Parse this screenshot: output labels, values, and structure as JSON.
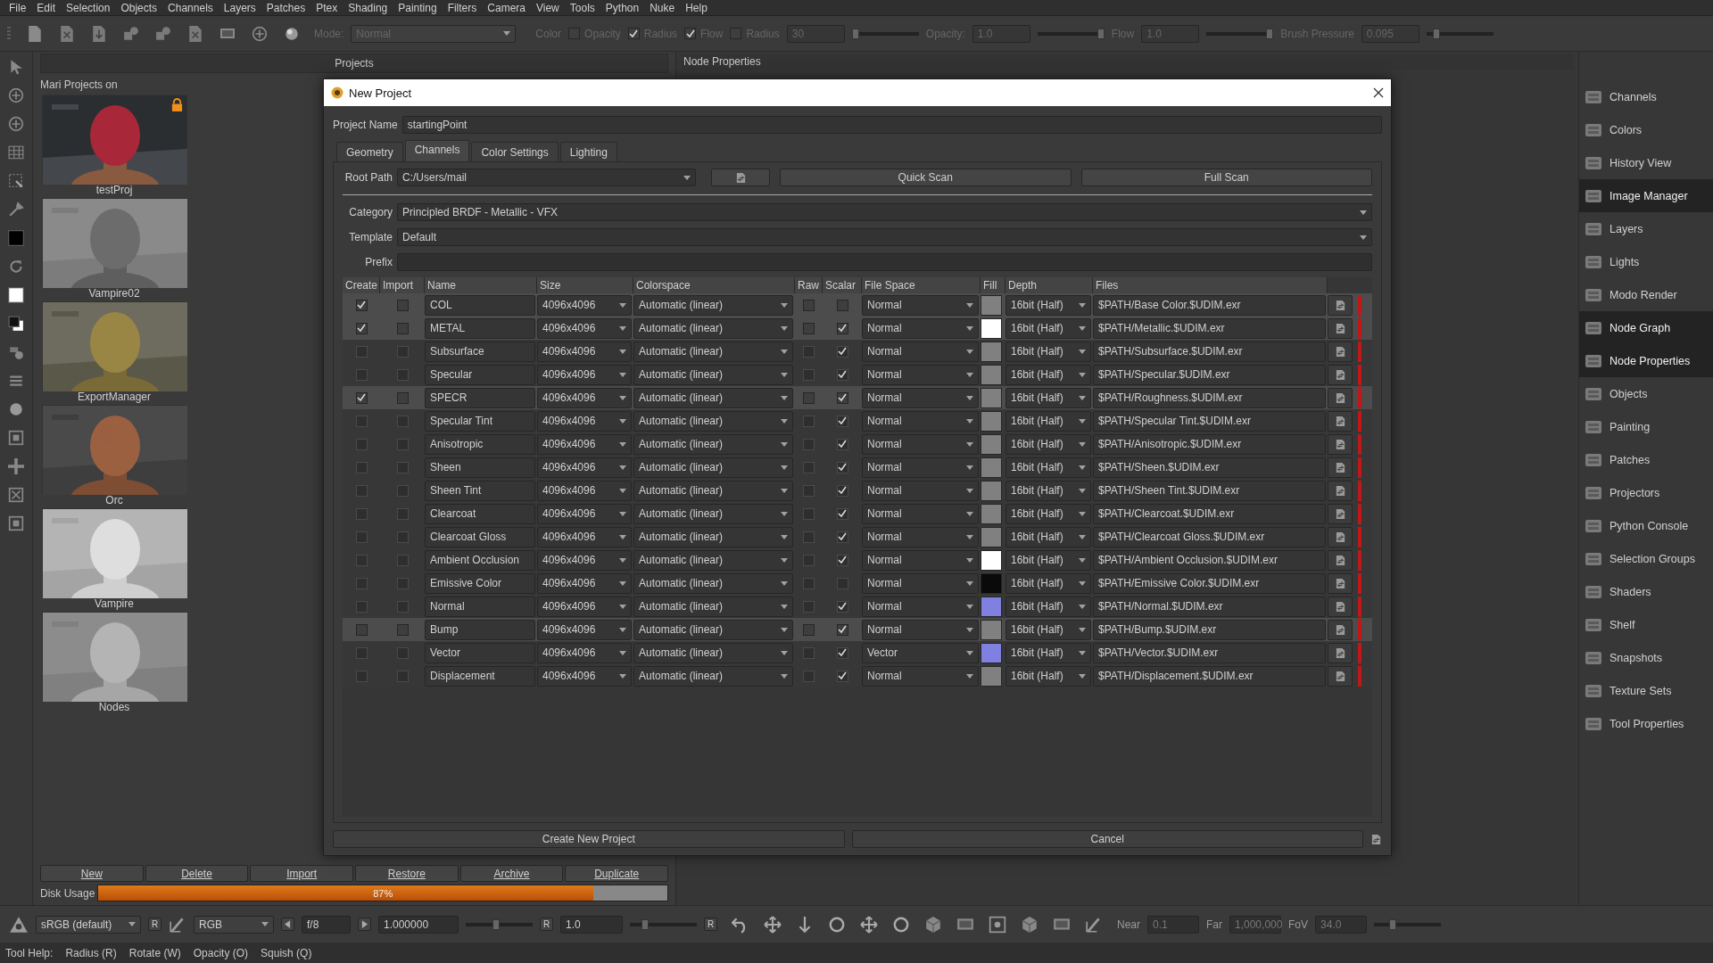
{
  "menu": [
    "File",
    "Edit",
    "Selection",
    "Objects",
    "Channels",
    "Layers",
    "Patches",
    "Ptex",
    "Shading",
    "Painting",
    "Filters",
    "Camera",
    "View",
    "Tools",
    "Python",
    "Nuke",
    "Help"
  ],
  "toolbar": {
    "mode_label": "Mode:",
    "mode": "Normal",
    "color_label": "Color",
    "checks": [
      {
        "label": "Opacity",
        "checked": false
      },
      {
        "label": "Radius",
        "checked": true
      },
      {
        "label": "Flow",
        "checked": true
      },
      {
        "label": "Radius",
        "checked": false
      }
    ],
    "fields": [
      {
        "value": "30",
        "level": 0.0
      },
      {
        "label": "Opacity:",
        "value": "1.0",
        "level": 1.0
      },
      {
        "label": "Flow",
        "value": "1.0",
        "level": 1.0
      },
      {
        "label": "Brush Pressure",
        "value": "0.095",
        "level": 0.1
      }
    ]
  },
  "projects": {
    "title": "Projects",
    "heading": "Mari Projects on",
    "items": [
      {
        "name": "testProj",
        "locked": true
      },
      {
        "name": "Vampire02",
        "locked": false
      },
      {
        "name": "ExportManager",
        "locked": false
      },
      {
        "name": "Orc",
        "locked": false
      },
      {
        "name": "Vampire",
        "locked": false
      },
      {
        "name": "Nodes",
        "locked": false
      }
    ],
    "buttons": [
      "New",
      "Delete",
      "Import",
      "Restore",
      "Archive",
      "Duplicate"
    ],
    "disk_label": "Disk Usage",
    "disk_usage": "87%",
    "level": 0.87
  },
  "node_properties": {
    "title": "Node Properties"
  },
  "dialog": {
    "title": "New Project",
    "project_name_label": "Project Name",
    "project_name": "startingPoint",
    "tabs": [
      {
        "label": "Geometry",
        "selected": false
      },
      {
        "label": "Channels",
        "selected": true
      },
      {
        "label": "Color Settings",
        "selected": false
      },
      {
        "label": "Lighting",
        "selected": false
      }
    ],
    "root_path_label": "Root Path",
    "root_path": "C:/Users/mail",
    "quick_scan": "Quick Scan",
    "full_scan": "Full Scan",
    "category_label": "Category",
    "category": "Principled BRDF - Metallic - VFX",
    "template_label": "Template",
    "template": "Default",
    "prefix_label": "Prefix",
    "columns": [
      "Create",
      "Import",
      "Name",
      "Size",
      "Colorspace",
      "Raw",
      "Scalar",
      "File Space",
      "Fill",
      "Depth",
      "Files"
    ],
    "rows": [
      {
        "selected": true,
        "create": true,
        "import": false,
        "name": "COL",
        "size": "4096x4096",
        "colorspace": "Automatic (linear)",
        "raw": false,
        "scalar": false,
        "file_space": "Normal",
        "color": "#808080",
        "depth": "16bit (Half)",
        "file": "$PATH/Base Color.$UDIM.exr"
      },
      {
        "selected": true,
        "create": true,
        "import": false,
        "name": "METAL",
        "size": "4096x4096",
        "colorspace": "Automatic (linear)",
        "raw": false,
        "scalar": true,
        "file_space": "Normal",
        "color": "#ffffff",
        "depth": "16bit (Half)",
        "file": "$PATH/Metallic.$UDIM.exr"
      },
      {
        "selected": false,
        "create": false,
        "import": false,
        "name": "Subsurface",
        "size": "4096x4096",
        "colorspace": "Automatic (linear)",
        "raw": false,
        "scalar": true,
        "file_space": "Normal",
        "color": "#808080",
        "depth": "16bit (Half)",
        "file": "$PATH/Subsurface.$UDIM.exr"
      },
      {
        "selected": false,
        "create": false,
        "import": false,
        "name": "Specular",
        "size": "4096x4096",
        "colorspace": "Automatic (linear)",
        "raw": false,
        "scalar": true,
        "file_space": "Normal",
        "color": "#808080",
        "depth": "16bit (Half)",
        "file": "$PATH/Specular.$UDIM.exr"
      },
      {
        "selected": true,
        "create": true,
        "import": false,
        "name": "SPECR",
        "size": "4096x4096",
        "colorspace": "Automatic (linear)",
        "raw": false,
        "scalar": true,
        "file_space": "Normal",
        "color": "#808080",
        "depth": "16bit (Half)",
        "file": "$PATH/Roughness.$UDIM.exr"
      },
      {
        "selected": false,
        "create": false,
        "import": false,
        "name": "Specular Tint",
        "size": "4096x4096",
        "colorspace": "Automatic (linear)",
        "raw": false,
        "scalar": true,
        "file_space": "Normal",
        "color": "#808080",
        "depth": "16bit (Half)",
        "file": "$PATH/Specular Tint.$UDIM.exr"
      },
      {
        "selected": false,
        "create": false,
        "import": false,
        "name": "Anisotropic",
        "size": "4096x4096",
        "colorspace": "Automatic (linear)",
        "raw": false,
        "scalar": true,
        "file_space": "Normal",
        "color": "#808080",
        "depth": "16bit (Half)",
        "file": "$PATH/Anisotropic.$UDIM.exr"
      },
      {
        "selected": false,
        "create": false,
        "import": false,
        "name": "Sheen",
        "size": "4096x4096",
        "colorspace": "Automatic (linear)",
        "raw": false,
        "scalar": true,
        "file_space": "Normal",
        "color": "#808080",
        "depth": "16bit (Half)",
        "file": "$PATH/Sheen.$UDIM.exr"
      },
      {
        "selected": false,
        "create": false,
        "import": false,
        "name": "Sheen Tint",
        "size": "4096x4096",
        "colorspace": "Automatic (linear)",
        "raw": false,
        "scalar": true,
        "file_space": "Normal",
        "color": "#808080",
        "depth": "16bit (Half)",
        "file": "$PATH/Sheen Tint.$UDIM.exr"
      },
      {
        "selected": false,
        "create": false,
        "import": false,
        "name": "Clearcoat",
        "size": "4096x4096",
        "colorspace": "Automatic (linear)",
        "raw": false,
        "scalar": true,
        "file_space": "Normal",
        "color": "#808080",
        "depth": "16bit (Half)",
        "file": "$PATH/Clearcoat.$UDIM.exr"
      },
      {
        "selected": false,
        "create": false,
        "import": false,
        "name": "Clearcoat Gloss",
        "size": "4096x4096",
        "colorspace": "Automatic (linear)",
        "raw": false,
        "scalar": true,
        "file_space": "Normal",
        "color": "#808080",
        "depth": "16bit (Half)",
        "file": "$PATH/Clearcoat Gloss.$UDIM.exr"
      },
      {
        "selected": false,
        "create": false,
        "import": false,
        "name": "Ambient Occlusion",
        "size": "4096x4096",
        "colorspace": "Automatic (linear)",
        "raw": false,
        "scalar": true,
        "file_space": "Normal",
        "color": "#ffffff",
        "depth": "16bit (Half)",
        "file": "$PATH/Ambient Occlusion.$UDIM.exr"
      },
      {
        "selected": false,
        "create": false,
        "import": false,
        "name": "Emissive Color",
        "size": "4096x4096",
        "colorspace": "Automatic (linear)",
        "raw": false,
        "scalar": false,
        "file_space": "Normal",
        "color": "#0a0a0a",
        "depth": "16bit (Half)",
        "file": "$PATH/Emissive Color.$UDIM.exr"
      },
      {
        "selected": false,
        "create": false,
        "import": false,
        "name": "Normal",
        "size": "4096x4096",
        "colorspace": "Automatic (linear)",
        "raw": false,
        "scalar": true,
        "file_space": "Normal",
        "color": "#8080e0",
        "depth": "16bit (Half)",
        "file": "$PATH/Normal.$UDIM.exr"
      },
      {
        "selected": true,
        "create": false,
        "import": false,
        "name": "Bump",
        "size": "4096x4096",
        "colorspace": "Automatic (linear)",
        "raw": false,
        "scalar": true,
        "file_space": "Normal",
        "color": "#808080",
        "depth": "16bit (Half)",
        "file": "$PATH/Bump.$UDIM.exr"
      },
      {
        "selected": false,
        "create": false,
        "import": false,
        "name": "Vector",
        "size": "4096x4096",
        "colorspace": "Automatic (linear)",
        "raw": false,
        "scalar": true,
        "file_space": "Vector",
        "color": "#8080e0",
        "depth": "16bit (Half)",
        "file": "$PATH/Vector.$UDIM.exr"
      },
      {
        "selected": false,
        "create": false,
        "import": false,
        "name": "Displacement",
        "size": "4096x4096",
        "colorspace": "Automatic (linear)",
        "raw": false,
        "scalar": true,
        "file_space": "Normal",
        "color": "#808080",
        "depth": "16bit (Half)",
        "file": "$PATH/Displacement.$UDIM.exr"
      }
    ],
    "create_button": "Create New Project",
    "cancel_button": "Cancel"
  },
  "sidebar": [
    {
      "label": "Channels",
      "active": false
    },
    {
      "label": "Colors",
      "active": false
    },
    {
      "label": "History View",
      "active": false
    },
    {
      "label": "Image Manager",
      "active": true
    },
    {
      "label": "Layers",
      "active": false
    },
    {
      "label": "Lights",
      "active": false
    },
    {
      "label": "Modo Render",
      "active": false
    },
    {
      "label": "Node Graph",
      "active": true
    },
    {
      "label": "Node Properties",
      "active": true
    },
    {
      "label": "Objects",
      "active": false
    },
    {
      "label": "Painting",
      "active": false
    },
    {
      "label": "Patches",
      "active": false
    },
    {
      "label": "Projectors",
      "active": false
    },
    {
      "label": "Python Console",
      "active": false
    },
    {
      "label": "Selection Groups",
      "active": false
    },
    {
      "label": "Shaders",
      "active": false
    },
    {
      "label": "Shelf",
      "active": false
    },
    {
      "label": "Snapshots",
      "active": false
    },
    {
      "label": "Texture Sets",
      "active": false
    },
    {
      "label": "Tool Properties",
      "active": false
    }
  ],
  "bottom_bar": {
    "colorspace": "sRGB (default)",
    "reset": [
      "R",
      "R",
      "R"
    ],
    "channels": "RGB",
    "fstop": "f/8",
    "exposure": "1.000000",
    "gamma": "1.0",
    "sliders": [
      {
        "level": 0.45
      },
      {
        "level": 0.2
      },
      {
        "level": 0.25
      }
    ],
    "near_label": "Near",
    "near": "0.1",
    "far_label": "Far",
    "far": "1,000,000",
    "fov_label": "FoV",
    "fov": "34.0"
  },
  "status": [
    "Tool Help:",
    "Radius (R)",
    "Rotate (W)",
    "Opacity (O)",
    "Squish (Q)"
  ]
}
